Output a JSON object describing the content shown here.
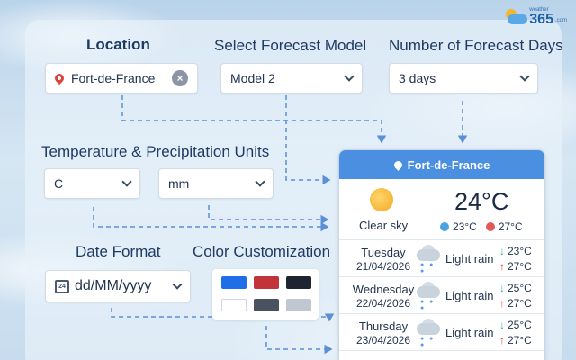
{
  "brand": {
    "small_top": "weather",
    "name": "365",
    "small_bottom": ".com"
  },
  "colors": {
    "accent": "#4a8fe0",
    "pin": "#d9443a",
    "min_dot": "#4aa3e0",
    "max_dot": "#e05a5a"
  },
  "location": {
    "label": "Location",
    "value": "Fort-de-France"
  },
  "model": {
    "label": "Select Forecast Model",
    "value": "Model 2"
  },
  "days": {
    "label": "Number of Forecast Days",
    "value": "3 days"
  },
  "units": {
    "label": "Temperature & Precipitation Units",
    "temperature": "C",
    "precipitation": "mm"
  },
  "date_format": {
    "label": "Date Format",
    "value": "dd/MM/yyyy",
    "calendar_day": "24"
  },
  "colors_custom": {
    "label": "Color Customization",
    "swatches": [
      "#1f6ee8",
      "#c0343a",
      "#1e2530",
      "#ffffff",
      "#4a5260",
      "#c1c7d0"
    ]
  },
  "card": {
    "location": "Fort-de-France",
    "current": {
      "temp": "24°C",
      "condition": "Clear sky",
      "min": "23°C",
      "max": "27°C"
    },
    "forecast": [
      {
        "day": "Tuesday",
        "date": "21/04/2026",
        "condition": "Light rain",
        "min": "23°C",
        "max": "27°C"
      },
      {
        "day": "Wednesday",
        "date": "22/04/2026",
        "condition": "Light rain",
        "min": "25°C",
        "max": "27°C"
      },
      {
        "day": "Thursday",
        "date": "23/04/2026",
        "condition": "Light rain",
        "min": "25°C",
        "max": "27°C"
      }
    ]
  }
}
